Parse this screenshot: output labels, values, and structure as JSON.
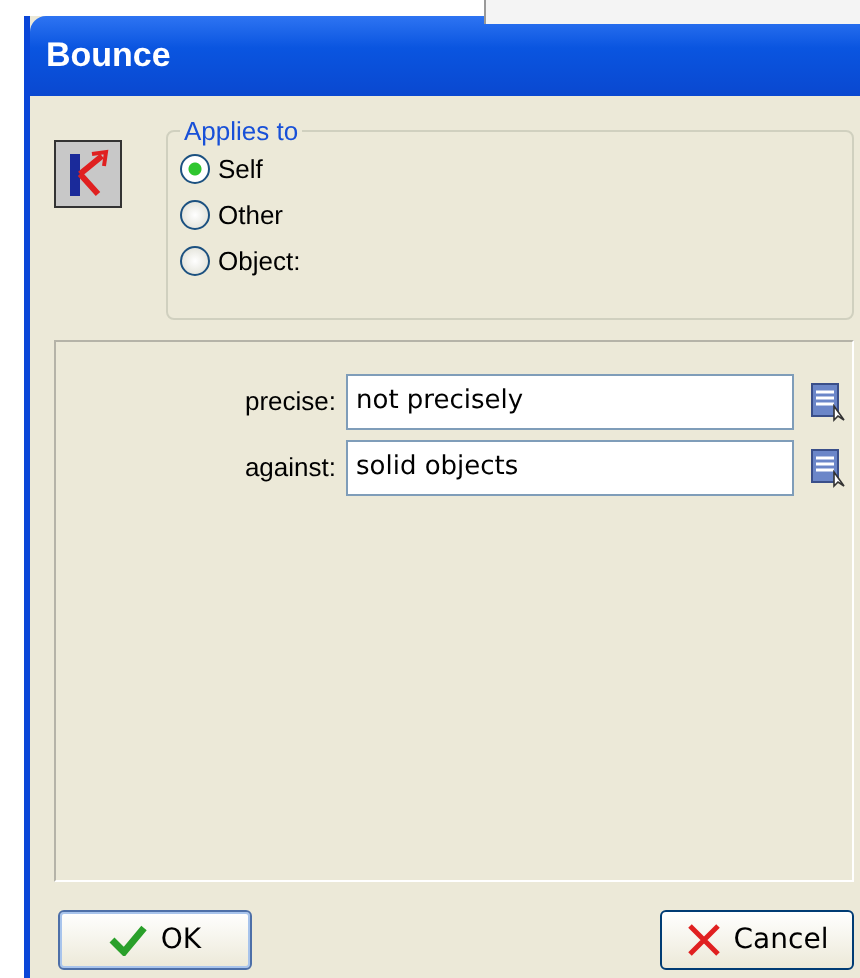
{
  "window": {
    "title": "Bounce"
  },
  "applies_to": {
    "label": "Applies to",
    "options": [
      {
        "label": "Self",
        "selected": true
      },
      {
        "label": "Other",
        "selected": false
      },
      {
        "label": "Object:",
        "selected": false
      }
    ]
  },
  "arguments": [
    {
      "label": "precise:",
      "value": "not precisely"
    },
    {
      "label": "against:",
      "value": "solid objects"
    }
  ],
  "buttons": [
    {
      "kind": "ok",
      "label": "OK"
    },
    {
      "kind": "cancel",
      "label": "Cancel"
    }
  ]
}
